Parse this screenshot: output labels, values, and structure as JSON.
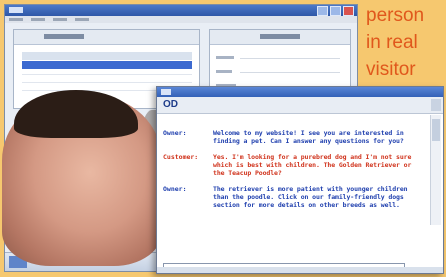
{
  "headline": {
    "lines": [
      "person",
      "in real",
      "visitor"
    ]
  },
  "chat": {
    "logo": "OD",
    "messages": [
      {
        "speaker": "Owner:",
        "role": "owner",
        "text": "Welcome to my website! I see you are interested in finding a pet. Can I answer any questions for you?"
      },
      {
        "speaker": "Customer:",
        "role": "customer",
        "text": "Yes. I'm looking for a purebred dog and I'm not sure which is best with children. The Golden Retriever or the Teacup Poodle?"
      },
      {
        "speaker": "Owner:",
        "role": "owner",
        "text": "The retriever is more patient with younger children than the poodle. Click on our family-friendly dogs section for more details on other breeds as well."
      }
    ]
  },
  "colors": {
    "background": "#f6c86f",
    "headline": "#e0581c",
    "owner": "#1f3fae",
    "customer": "#d0331c"
  }
}
